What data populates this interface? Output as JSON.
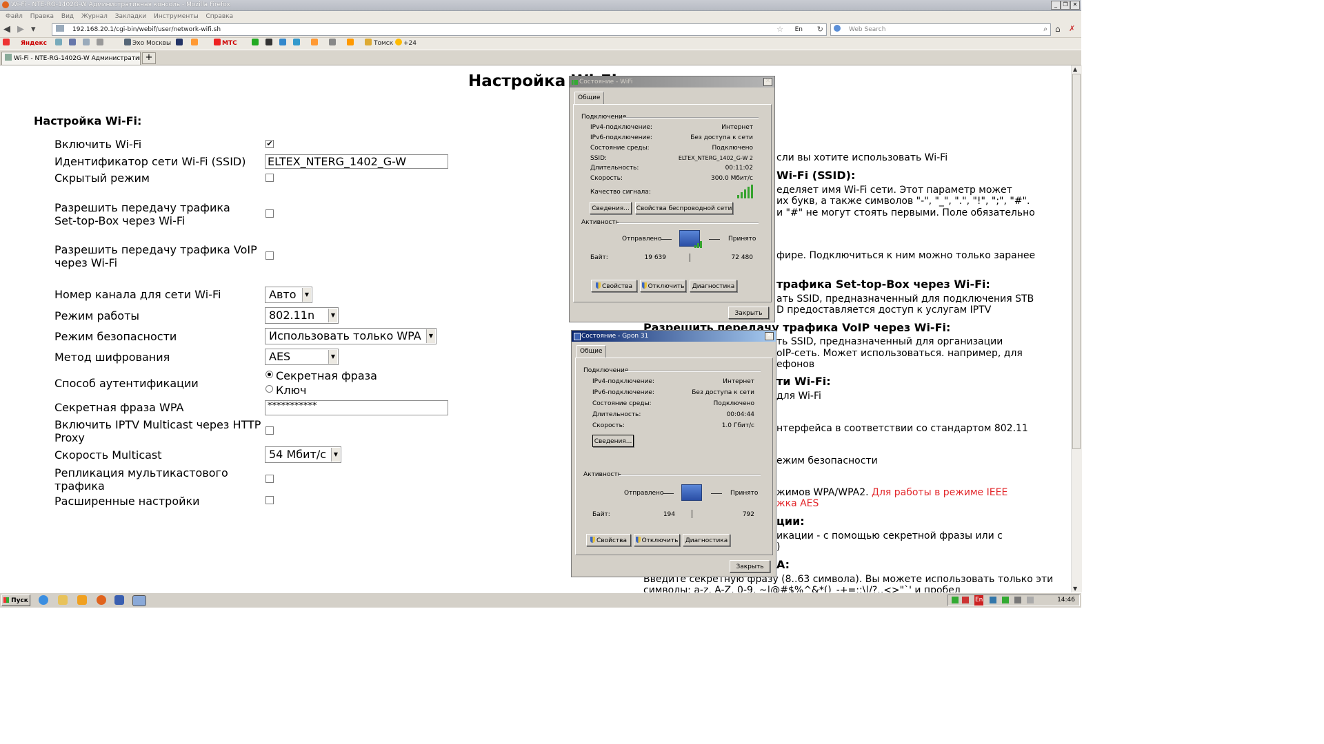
{
  "window": {
    "title": "Wi-Fi - NTE-RG-1402G-W Административная консоль - Mozilla Firefox"
  },
  "menu": [
    "Файл",
    "Правка",
    "Вид",
    "Журнал",
    "Закладки",
    "Инструменты",
    "Справка"
  ],
  "nav": {
    "url": "192.168.20.1/cgi-bin/webif/user/network-wifi.sh",
    "lang": "En",
    "search_placeholder": "Web Search"
  },
  "bookmarks": [
    "Яндекс",
    "Эхо Москвы",
    "МТС",
    "Томск",
    "+24"
  ],
  "tab": {
    "label": "Wi-Fi - NTE-RG-1402G-W Административна...",
    "new_tab": "+"
  },
  "page": {
    "title": "Настройка Wi-Fi",
    "section": "Настройка Wi-Fi:",
    "labels": {
      "enable_wifi": "Включить Wi-Fi",
      "ssid": "Идентификатор сети Wi-Fi (SSID)",
      "hidden": "Скрытый режим",
      "stb_1": "Разрешить передачу трафика",
      "stb_2": "Set-top-Box через Wi-Fi",
      "voip_1": "Разрешить передачу трафика VoIP",
      "voip_2": "через Wi-Fi",
      "channel": "Номер канала для сети Wi-Fi",
      "mode": "Режим работы",
      "security": "Режим безопасности",
      "cipher": "Метод шифрования",
      "auth": "Способ аутентификации",
      "passphrase": "Секретная фраза WPA",
      "iptv_1": "Включить IPTV Multicast через HTTP",
      "iptv_2": "Proxy",
      "mc_speed": "Скорость Multicast",
      "repl_1": "Репликация мультикастового",
      "repl_2": "трафика",
      "advanced": "Расширенные настройки"
    },
    "values": {
      "enable_wifi": "✔",
      "ssid": "ELTEX_NTERG_1402_G-W",
      "channel": "Авто",
      "mode": "802.11n",
      "security": "Использовать только WPA",
      "cipher": "AES",
      "auth_opt1": "Секретная фраза",
      "auth_opt2": "Ключ",
      "passphrase": "***********",
      "mc_speed": "54 Мбит/с"
    }
  },
  "help": {
    "l1": "сли вы хотите использовать Wi-Fi",
    "h1": "Wi-Fi (SSID):",
    "l2": "еделяет имя Wi-Fi сети. Этот параметр может",
    "l3": "их букв, а также символов \"-\", \"_\", \".\", \"!\", \";\", \"#\".",
    "l4": "и \"#\" не могут стоять первыми. Поле обязательно",
    "l5": "фире. Подключиться к ним можно только заранее",
    "h2": "трафика Set-top-Box через Wi-Fi:",
    "l6": "ать SSID, предназначенный для подключения STB",
    "l7": "D предоставляется доступ к услугам IPTV",
    "h3": "Разрешить передачу трафика VoIP через Wi-Fi:",
    "l8": "ть SSID, предназначенный для организации",
    "l9": "oIP-сеть. Может использоваться. например, для",
    "l10": "ефонов",
    "h4": "ти Wi-Fi:",
    "l11": "для Wi-Fi",
    "l12": "нтерфейса в соответствии со стандартом 802.11",
    "l13": "ежим безопасности",
    "l14": "жимов WPA/WPA2.",
    "l14r": "Для работы в режиме IEEE",
    "l15r": "жка AES",
    "h5": "ции:",
    "l16": "икации - с помощью секретной фразы или с",
    "l17": ")",
    "h6": "A:",
    "l18": "Введите секретную фразу (8..63 символа). Вы можете использовать только эти",
    "l19": "символы: a-z, A-Z, 0-9, ~|@#$%^&*()_-+=:;\\|/?.,<>\"`' и пробел"
  },
  "dlg_wifi": {
    "title": "Состояние - WiFi",
    "tab": "Общие",
    "conn": "Подключение",
    "keys": [
      "IPv4-подключение:",
      "IPv6-подключение:",
      "Состояние среды:",
      "SSID:",
      "Длительность:",
      "Скорость:"
    ],
    "vals": [
      "Интернет",
      "Без доступа к сети",
      "Подключено",
      "ELTEX_NTERG_1402_G-W 2",
      "00:11:02",
      "300.0 Мбит/с"
    ],
    "signal": "Качество сигнала:",
    "details": "Сведения...",
    "wprops": "Свойства беспроводной сети",
    "activity": "Активность",
    "sent": "Отправлено",
    "recv": "Принято",
    "bytes": "Байт:",
    "sent_val": "19 639",
    "recv_val": "72 480",
    "props": "Свойства",
    "disable": "Отключить",
    "diag": "Диагностика",
    "close": "Закрыть"
  },
  "dlg_gpon": {
    "title": "Состояние - Gpon 31",
    "tab": "Общие",
    "conn": "Подключение",
    "keys": [
      "IPv4-подключение:",
      "IPv6-подключение:",
      "Состояние среды:",
      "Длительность:",
      "Скорость:"
    ],
    "vals": [
      "Интернет",
      "Без доступа к сети",
      "Подключено",
      "00:04:44",
      "1.0 Гбит/с"
    ],
    "details": "Сведения...",
    "activity": "Активность",
    "sent": "Отправлено",
    "recv": "Принято",
    "bytes": "Байт:",
    "sent_val": "194",
    "recv_val": "792",
    "props": "Свойства",
    "disable": "Отключить",
    "diag": "Диагностика",
    "close": "Закрыть"
  },
  "taskbar": {
    "start": "Пуск",
    "lang": "En",
    "clock": "14:46"
  },
  "colors": {
    "accent_red": "#e2262a",
    "dialog_active": "#0a246a",
    "dialog_inactive": "#808080"
  }
}
